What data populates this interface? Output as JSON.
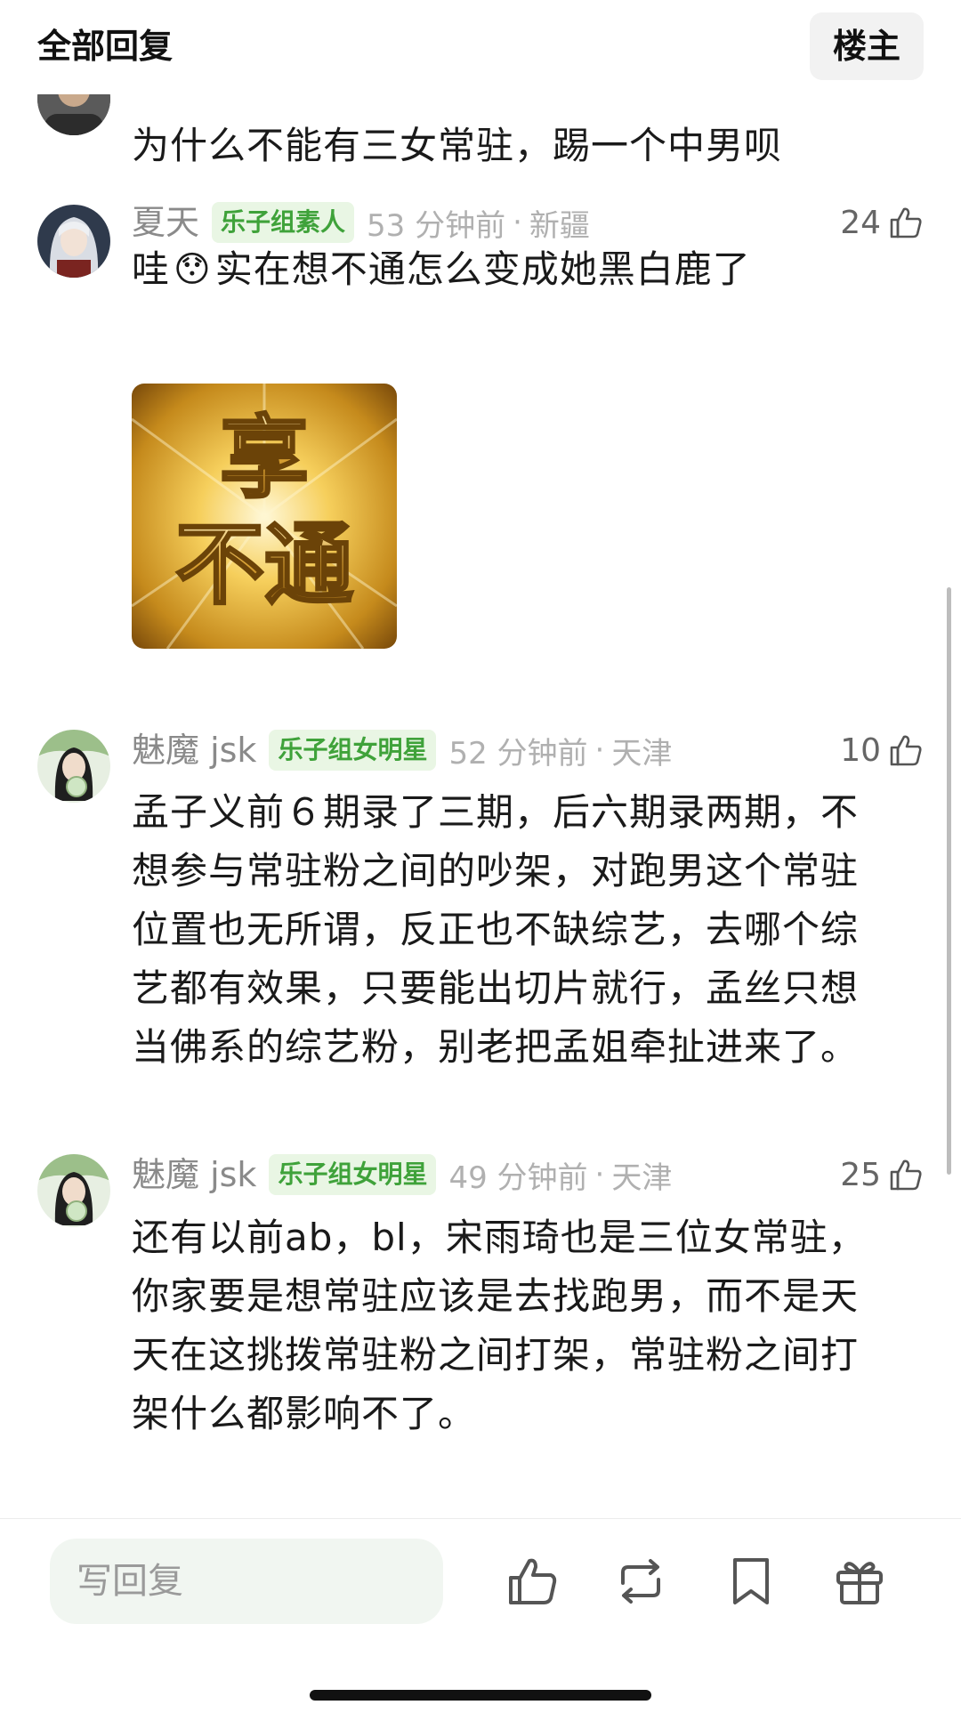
{
  "header": {
    "title": "全部回复",
    "op_button": "楼主"
  },
  "comments": [
    {
      "text": "为什么不能有三女常驻，踢一个中男呗"
    },
    {
      "name": "夏天",
      "badge": "乐子组素人",
      "time": "53 分钟前",
      "location": "新疆",
      "likes": "24",
      "text_before": "哇",
      "emoji": "😯",
      "text_after": "实在想不通怎么变成她黑白鹿了",
      "sticker_line1": "享",
      "sticker_line2": "不通"
    },
    {
      "name": "魅魔 jsk",
      "badge": "乐子组女明星",
      "time": "52 分钟前",
      "location": "天津",
      "likes": "10",
      "lines": [
        "孟子义前６期录了三期，后六期录两期，不",
        "想参与常驻粉之间的吵架，对跑男这个常驻",
        "位置也无所谓，反正也不缺综艺，去哪个综",
        "艺都有效果，只要能出切片就行，孟丝只想",
        "当佛系的综艺粉，别老把孟姐牵扯进来了。"
      ]
    },
    {
      "name": "魅魔 jsk",
      "badge": "乐子组女明星",
      "time": "49 分钟前",
      "location": "天津",
      "likes": "25",
      "lines": [
        "还有以前ab，bl，宋雨琦也是三位女常驻，",
        "你家要是想常驻应该是去找跑男，而不是天",
        "天在这挑拨常驻粉之间打架，常驻粉之间打",
        "架什么都影响不了。"
      ]
    }
  ],
  "bottom_bar": {
    "reply_placeholder": "写回复"
  },
  "colors": {
    "badge_bg": "#e9f6e4",
    "badge_text": "#3fa23a",
    "meta_gray": "#b0b0b0"
  }
}
